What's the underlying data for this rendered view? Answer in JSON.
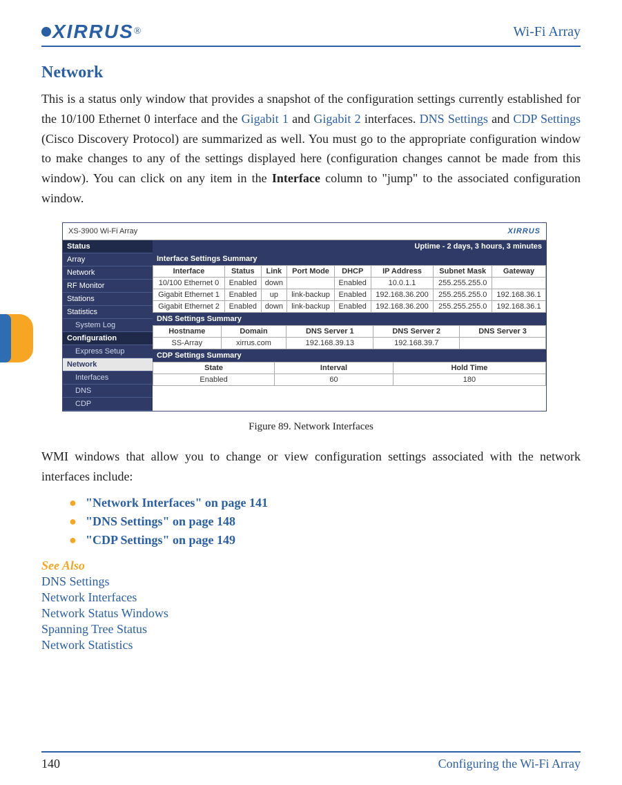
{
  "header": {
    "logo_text": "XIRRUS",
    "doc_title": "Wi-Fi Array"
  },
  "section": {
    "title": "Network"
  },
  "paragraph": {
    "p1a": "This is a status only window that provides a snapshot of the configuration settings currently established for the 10/100 Ethernet 0 interface and the ",
    "gigabit1": "Gigabit 1",
    "p1b": " and ",
    "gigabit2": "Gigabit 2",
    "p1c": " interfaces. ",
    "dns_settings": "DNS Settings",
    "p1d": " and ",
    "cdp_settings": "CDP Settings",
    "p1e": " (Cisco Discovery Protocol) are summarized as well. You must go to the appropriate configuration window to make changes to any of the settings displayed here (configuration changes cannot be made from this window). You can click on any item in the ",
    "interface_bold": "Interface",
    "p1f": " column to \"jump\" to the associated configuration window."
  },
  "figure": {
    "window_title": "XS-3900 Wi-Fi Array",
    "logo": "XIRRUS",
    "status_label": "Status",
    "uptime": "Uptime - 2 days, 3 hours, 3 minutes",
    "sidebar": {
      "items": [
        "Array",
        "Network",
        "RF Monitor",
        "Stations",
        "Statistics",
        "System Log"
      ],
      "config_label": "Configuration",
      "express": "Express Setup",
      "network": "Network",
      "subitems": [
        "Interfaces",
        "DNS",
        "CDP"
      ]
    },
    "interface_summary": {
      "title": "Interface Settings Summary",
      "headers": [
        "Interface",
        "Status",
        "Link",
        "Port Mode",
        "DHCP",
        "IP Address",
        "Subnet Mask",
        "Gateway"
      ],
      "rows": [
        [
          "10/100 Ethernet 0",
          "Enabled",
          "down",
          "",
          "Enabled",
          "10.0.1.1",
          "255.255.255.0",
          ""
        ],
        [
          "Gigabit Ethernet 1",
          "Enabled",
          "up",
          "link-backup",
          "Enabled",
          "192.168.36.200",
          "255.255.255.0",
          "192.168.36.1"
        ],
        [
          "Gigabit Ethernet 2",
          "Enabled",
          "down",
          "link-backup",
          "Enabled",
          "192.168.36.200",
          "255.255.255.0",
          "192.168.36.1"
        ]
      ]
    },
    "dns_summary": {
      "title": "DNS Settings Summary",
      "headers": [
        "Hostname",
        "Domain",
        "DNS Server 1",
        "DNS Server 2",
        "DNS Server 3"
      ],
      "row": [
        "SS-Array",
        "xirrus.com",
        "192.168.39.13",
        "192.168.39.7",
        ""
      ]
    },
    "cdp_summary": {
      "title": "CDP Settings Summary",
      "headers": [
        "State",
        "Interval",
        "Hold Time"
      ],
      "row": [
        "Enabled",
        "60",
        "180"
      ]
    },
    "caption": "Figure 89. Network Interfaces"
  },
  "para2": "WMI windows that allow you to change or view configuration settings associated with the network interfaces include:",
  "links": [
    "\"Network Interfaces\" on page 141",
    "\"DNS Settings\" on page 148",
    "\"CDP Settings\" on page 149"
  ],
  "see_also": {
    "title": "See Also",
    "items": [
      "DNS Settings",
      "Network Interfaces",
      "Network Status Windows",
      "Spanning Tree Status",
      "Network Statistics"
    ]
  },
  "footer": {
    "page": "140",
    "text": "Configuring the Wi-Fi Array"
  }
}
